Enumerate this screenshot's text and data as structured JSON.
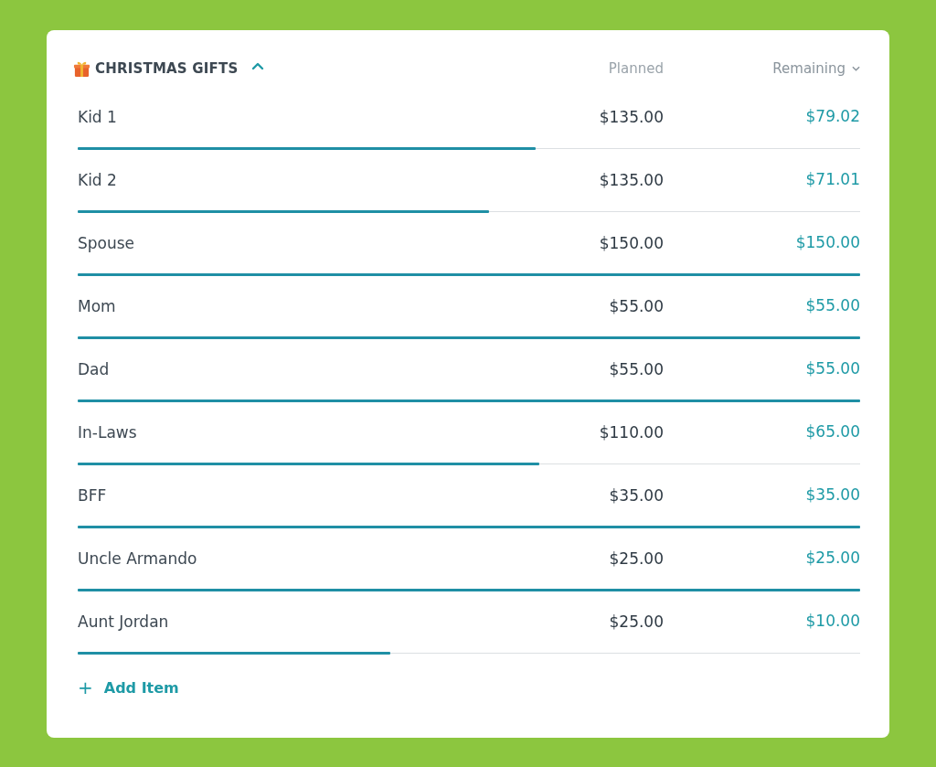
{
  "group": {
    "title": "CHRISTMAS GIFTS",
    "expanded": true
  },
  "columns": {
    "planned": "Planned",
    "remaining": "Remaining"
  },
  "items": [
    {
      "name": "Kid 1",
      "planned": "$135.00",
      "remaining": "$79.02",
      "level": 0.585
    },
    {
      "name": "Kid 2",
      "planned": "$135.00",
      "remaining": "$71.01",
      "level": 0.526
    },
    {
      "name": "Spouse",
      "planned": "$150.00",
      "remaining": "$150.00",
      "level": 1
    },
    {
      "name": "Mom",
      "planned": "$55.00",
      "remaining": "$55.00",
      "level": 1
    },
    {
      "name": "Dad",
      "planned": "$55.00",
      "remaining": "$55.00",
      "level": 1
    },
    {
      "name": "In-Laws",
      "planned": "$110.00",
      "remaining": "$65.00",
      "level": 0.59
    },
    {
      "name": "BFF",
      "planned": "$35.00",
      "remaining": "$35.00",
      "level": 1
    },
    {
      "name": "Uncle Armando",
      "planned": "$25.00",
      "remaining": "$25.00",
      "level": 1
    },
    {
      "name": "Aunt Jordan",
      "planned": "$25.00",
      "remaining": "$10.00",
      "level": 0.4
    }
  ],
  "add_item": {
    "icon": "+",
    "label": "Add Item"
  }
}
